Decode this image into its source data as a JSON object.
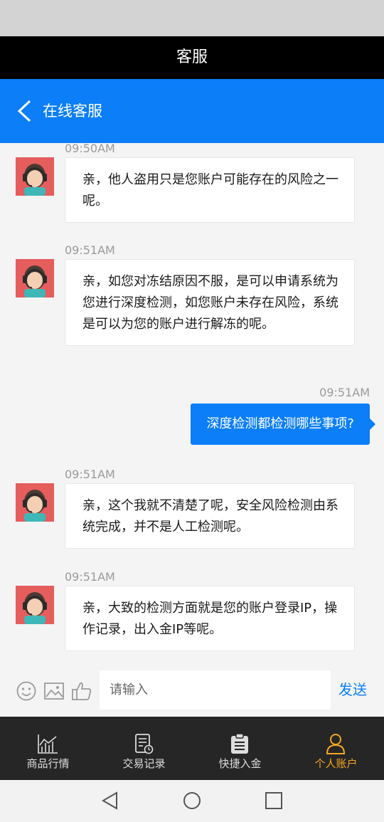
{
  "header": {
    "title": "客服"
  },
  "nav": {
    "title": "在线客服"
  },
  "messages": [
    {
      "time": "09:50AM",
      "text": "亲，他人盗用只是您账户可能存在的风险之一呢。"
    },
    {
      "time": "09:51AM",
      "text": "亲，如您对冻结原因不服，是可以申请系统为您进行深度检测，如您账户未存在风险，系统是可以为您的账户进行解冻的呢。"
    },
    {
      "time": "09:51AM",
      "text": "深度检测都检测哪些事项?"
    },
    {
      "time": "09:51AM",
      "text": "亲，这个我就不清楚了呢，安全风险检测由系统完成，并不是人工检测呢。"
    },
    {
      "time": "09:51AM",
      "text": "亲，大致的检测方面就是您的账户登录IP，操作记录，出入金IP等呢。"
    }
  ],
  "input": {
    "placeholder": "请输入",
    "send_label": "发送"
  },
  "tabs": [
    {
      "label": "商品行情",
      "icon": "chart-icon"
    },
    {
      "label": "交易记录",
      "icon": "record-icon"
    },
    {
      "label": "快捷入金",
      "icon": "clipboard-icon"
    },
    {
      "label": "个人账户",
      "icon": "user-icon"
    }
  ],
  "colors": {
    "accent": "#0b7ef8",
    "active_tab": "#f5a623",
    "tab_inactive": "#dddddd",
    "tab_bar_bg": "#262626"
  }
}
